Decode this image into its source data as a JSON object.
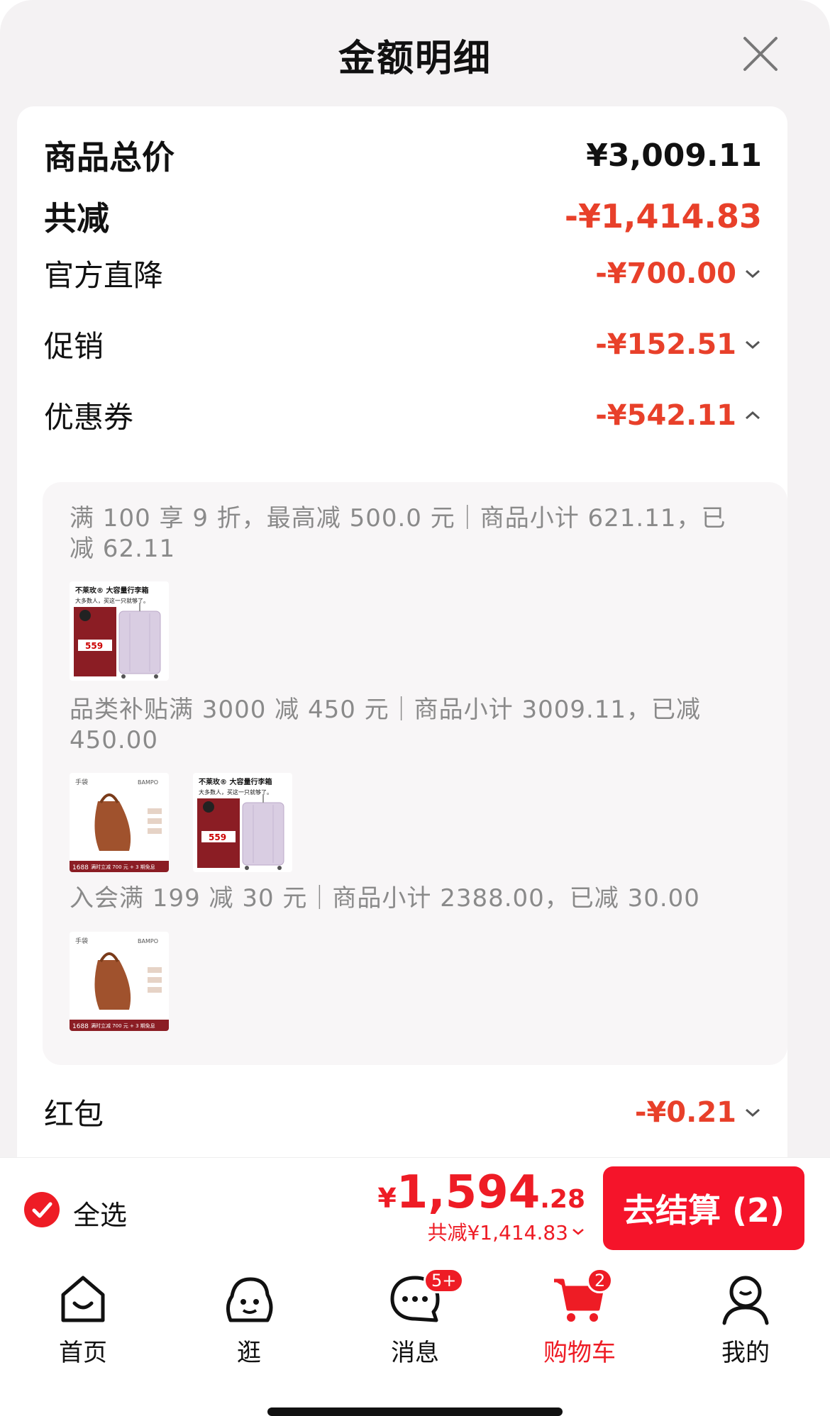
{
  "sheet": {
    "title": "金额明细"
  },
  "summary": {
    "subtotal_label": "商品总价",
    "subtotal_value": "¥3,009.11",
    "total_reduction_label": "共减",
    "total_reduction_value": "-¥1,414.83"
  },
  "details": [
    {
      "label": "官方直降",
      "value": "-¥700.00",
      "chevron": "down"
    },
    {
      "label": "促销",
      "value": "-¥152.51",
      "chevron": "down"
    },
    {
      "label": "优惠券",
      "value": "-¥542.11",
      "chevron": "up"
    }
  ],
  "coupons": [
    {
      "text": "满 100 享 9 折，最高减 500.0 元｜商品小计 621.11，已减 62.11"
    },
    {
      "text": "品类补贴满 3000 减 450 元｜商品小计 3009.11，已减 450.00"
    },
    {
      "text": "入会满 199 减 30 元｜商品小计 2388.00，已减 30.00"
    }
  ],
  "thumbs": {
    "suitcase": {
      "title": "不莱玫® 大容量行李箱",
      "subtitle": "大多数人，买这一只就够了。",
      "price": "559"
    },
    "bag": {
      "brand_left": "手袋",
      "brand_right": "BAMPO",
      "price_tag": "1688",
      "promo": "满时立减 700 元 + 3 期免息"
    }
  },
  "red_packet": {
    "label": "红包",
    "value": "-¥0.21"
  },
  "bottom": {
    "select_all": "全选",
    "price_currency": "¥",
    "price_int": "1,594",
    "price_dec": ".28",
    "saved": "共减¥1,414.83",
    "checkout": "去结算 (2)"
  },
  "tabs": [
    {
      "label": "首页",
      "icon": "home-icon"
    },
    {
      "label": "逛",
      "icon": "explore-icon"
    },
    {
      "label": "消息",
      "icon": "message-icon",
      "badge": "5+"
    },
    {
      "label": "购物车",
      "icon": "cart-icon",
      "badge": "2"
    },
    {
      "label": "我的",
      "icon": "profile-icon"
    }
  ],
  "colors": {
    "accent": "#ee1c25",
    "discount": "#e8402a"
  }
}
